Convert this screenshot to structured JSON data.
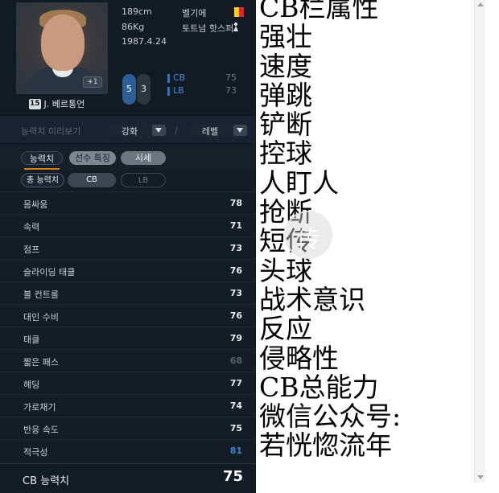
{
  "player": {
    "height": "189cm",
    "weight": "86Kg",
    "birth_date": "1987.4.24",
    "nation": "벨기에",
    "club": "토트넘 핫스퍼",
    "jersey_number": "15",
    "name": "J. 베르통언",
    "enhance_badge": "+1",
    "foot_left": "5",
    "foot_right": "3",
    "flag_colors": [
      "#1a1a1a",
      "#f5d40f",
      "#e0242b"
    ]
  },
  "positions": [
    {
      "pos": "CB",
      "value": "75"
    },
    {
      "pos": "LB",
      "value": "73"
    }
  ],
  "preview": {
    "label": "능력치 미리보기",
    "enhance_label": "강화",
    "level_label": "레벨",
    "separator": "/"
  },
  "tabs": {
    "stats": "능력치",
    "traits": "선수 특징",
    "price": "시세"
  },
  "subtabs": {
    "total": "총 능력치",
    "cb": "CB",
    "lb": "LB"
  },
  "stats": [
    {
      "name": "몸싸움",
      "value": "78",
      "style": "normal"
    },
    {
      "name": "속력",
      "value": "71",
      "style": "normal"
    },
    {
      "name": "점프",
      "value": "73",
      "style": "normal"
    },
    {
      "name": "슬라이딩 태클",
      "value": "76",
      "style": "normal"
    },
    {
      "name": "볼 컨트롤",
      "value": "73",
      "style": "normal"
    },
    {
      "name": "대인 수비",
      "value": "76",
      "style": "normal"
    },
    {
      "name": "태클",
      "value": "79",
      "style": "normal"
    },
    {
      "name": "짧은 패스",
      "value": "68",
      "style": "dim"
    },
    {
      "name": "헤딩",
      "value": "77",
      "style": "normal"
    },
    {
      "name": "가로채기",
      "value": "74",
      "style": "normal"
    },
    {
      "name": "반응 속도",
      "value": "75",
      "style": "normal"
    },
    {
      "name": "적극성",
      "value": "81",
      "style": "blue"
    }
  ],
  "total": {
    "label": "CB 능력치",
    "value": "75"
  },
  "text_lines": [
    "CB栏属性",
    "强壮",
    "速度",
    "弹跳",
    "铲断",
    "控球",
    "人盯人",
    "抢断",
    "短传",
    "头球",
    "战术意识",
    "反应",
    "侵略性",
    "CB总能力",
    "微信公众号:",
    "若恍惚流年"
  ],
  "watermark_char": "传"
}
